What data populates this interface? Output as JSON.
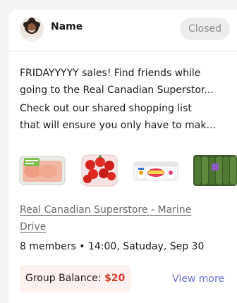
{
  "header": {
    "name": "Name",
    "status": "Closed"
  },
  "post": {
    "title_lines": [
      "FRIDAYYYYY sales! Find friends while",
      "going to the Real Canadian Superstor..."
    ],
    "description_lines": [
      "Check out our shared shopping list",
      "that will ensure you only have to mak..."
    ]
  },
  "products": [
    {
      "icon": "chicken-breast-package"
    },
    {
      "icon": "cherry-tomatoes-container"
    },
    {
      "icon": "yogurt-multipack"
    },
    {
      "icon": "cucumbers-package"
    }
  ],
  "location": {
    "line1": "Real Canadian Superstore - Marine",
    "line2": "Drive"
  },
  "meta": {
    "members": "8 members",
    "separator": "•",
    "datetime": "14:00, Satuday, Sep 30"
  },
  "footer": {
    "balance_label": "Group Balance:",
    "balance_amount": "$20",
    "view_more": "View more"
  },
  "colors": {
    "accent": "#6a74d8",
    "balance_amount": "#d33a2c",
    "balance_bg": "#fdf0ee",
    "badge_bg": "#ededed"
  }
}
